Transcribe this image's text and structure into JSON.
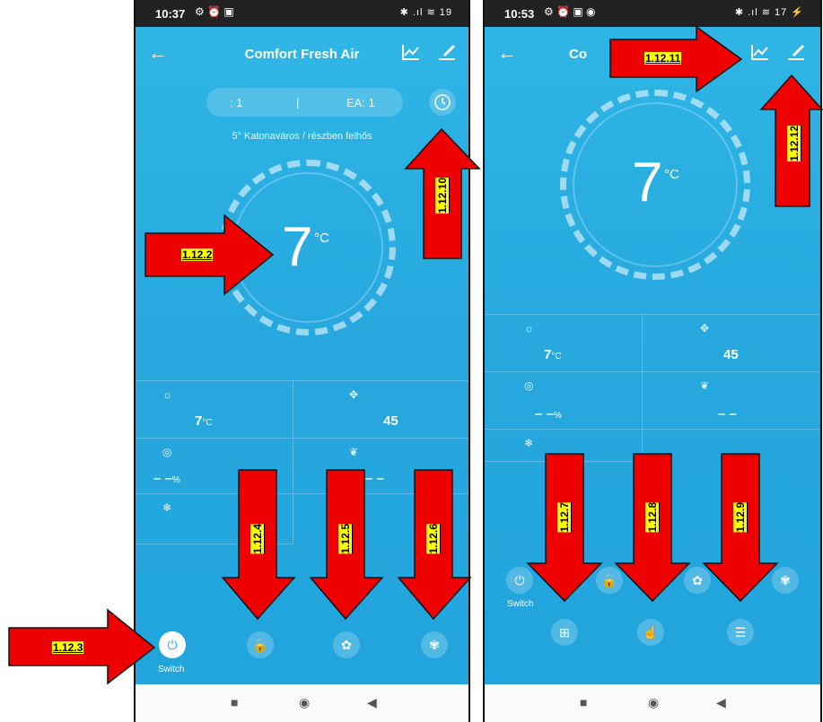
{
  "left_phone": {
    "status": {
      "time": "10:37",
      "icons": "⚙ ⏰ ▣",
      "right_icons": "✱ .ıl ≋ 19"
    },
    "title": "Comfort  Fresh Air",
    "pill": {
      "left": ": 1",
      "divider": "|",
      "right": "EA: 1"
    },
    "weather": "5°  Katonaváros  /  részben felhős",
    "big_temp": "7",
    "big_unit": "°C",
    "cells": [
      {
        "icon": "☼",
        "value": "7",
        "unit": "°C"
      },
      {
        "icon": "✥",
        "value": "45",
        "unit": ""
      },
      {
        "icon": "◎",
        "value": "– –",
        "unit": "%"
      },
      {
        "icon": "❦",
        "value": "– –",
        "unit": ""
      },
      {
        "icon": "❄",
        "value": "",
        "unit": ""
      }
    ],
    "buttons": {
      "switch_label": "Switch",
      "power": "⏻",
      "lock": "🔒",
      "fan": "✿",
      "fan2": "✾"
    }
  },
  "right_phone": {
    "status": {
      "time": "10:53",
      "icons": "⚙ ⏰ ▣ ◉",
      "right_icons": "✱ .ıl ≋ 17 ⚡"
    },
    "title": "Co",
    "big_temp": "7",
    "big_unit": "°C",
    "cells": [
      {
        "icon": "☼",
        "value": "7",
        "unit": "°C"
      },
      {
        "icon": "✥",
        "value": "45",
        "unit": ""
      },
      {
        "icon": "◎",
        "value": "– –",
        "unit": "%"
      },
      {
        "icon": "❦",
        "value": "– –",
        "unit": ""
      },
      {
        "icon": "❄",
        "value": "",
        "unit": ""
      }
    ],
    "buttons": {
      "switch_label": "Switch",
      "power": "⏻",
      "lock": "🔒",
      "fan": "✿",
      "fan2": "✾",
      "grid": "⊞",
      "hand": "☝",
      "mode": "☰"
    }
  },
  "annotations": {
    "a1": "1.12.2",
    "a2": "1.12.3",
    "a3": "1.12.4",
    "a4": "1.12.5",
    "a5": "1.12.6",
    "a6": "1.12.10",
    "a7": "1.12.11",
    "a8": "1.12.12",
    "a9": "1.12.7",
    "a10": "1.12.8",
    "a11": "1.12.9"
  },
  "colors": {
    "app_bg": "#27a9df",
    "arrow": "#ee0000",
    "label_bg": "#ffff00"
  }
}
